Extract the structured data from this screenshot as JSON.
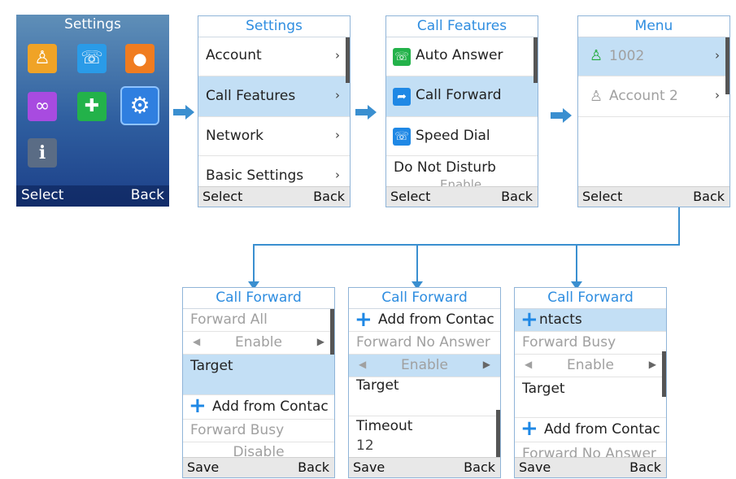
{
  "home": {
    "title": "Settings",
    "select": "Select",
    "back": "Back",
    "apps": [
      {
        "name": "contacts",
        "glyph": "👤",
        "color": "#f0a326"
      },
      {
        "name": "calls",
        "glyph": "☏",
        "color": "#2a9be8"
      },
      {
        "name": "messages",
        "glyph": "💬",
        "color": "#f07c20"
      },
      {
        "name": "voicemail",
        "glyph": "∞",
        "color": "#a84be0"
      },
      {
        "name": "security",
        "glyph": "✚",
        "color": "#23b24a"
      },
      {
        "name": "settings",
        "glyph": "⚙",
        "color": "#2f7fe0"
      },
      {
        "name": "info",
        "glyph": "i",
        "color": "#5a6c85"
      }
    ]
  },
  "settings": {
    "title": "Settings",
    "items": [
      "Account",
      "Call Features",
      "Network",
      "Basic Settings"
    ],
    "select": "Select",
    "back": "Back"
  },
  "call_features": {
    "title": "Call Features",
    "items": [
      "Auto Answer",
      "Call Forward",
      "Speed Dial",
      "Do Not Disturb"
    ],
    "dnd_value": "Enable",
    "select": "Select",
    "back": "Back"
  },
  "menu": {
    "title": "Menu",
    "accounts": [
      "1002",
      "Account 2"
    ],
    "select": "Select",
    "back": "Back"
  },
  "cf1": {
    "title": "Call Forward",
    "forward_all": "Forward All",
    "enable": "Enable",
    "target": "Target",
    "add": "Add from Contac",
    "forward_busy": "Forward Busy",
    "disable": "Disable",
    "save": "Save",
    "back": "Back"
  },
  "cf2": {
    "title": "Call Forward",
    "add": "Add from Contac",
    "forward_no_answer": "Forward No Answer",
    "enable": "Enable",
    "target": "Target",
    "timeout": "Timeout",
    "timeout_value": "12",
    "save": "Save",
    "back": "Back"
  },
  "cf3": {
    "title": "Call Forward",
    "contacts": "ntacts",
    "forward_busy": "Forward Busy",
    "enable": "Enable",
    "target": "Target",
    "add": "Add from Contac",
    "forward_no_answer": "Forward No Answer",
    "save": "Save",
    "back": "Back"
  },
  "colors": {
    "accent": "#2e8de0",
    "selected": "#c3dff5",
    "flow": "#3a8fd0"
  }
}
